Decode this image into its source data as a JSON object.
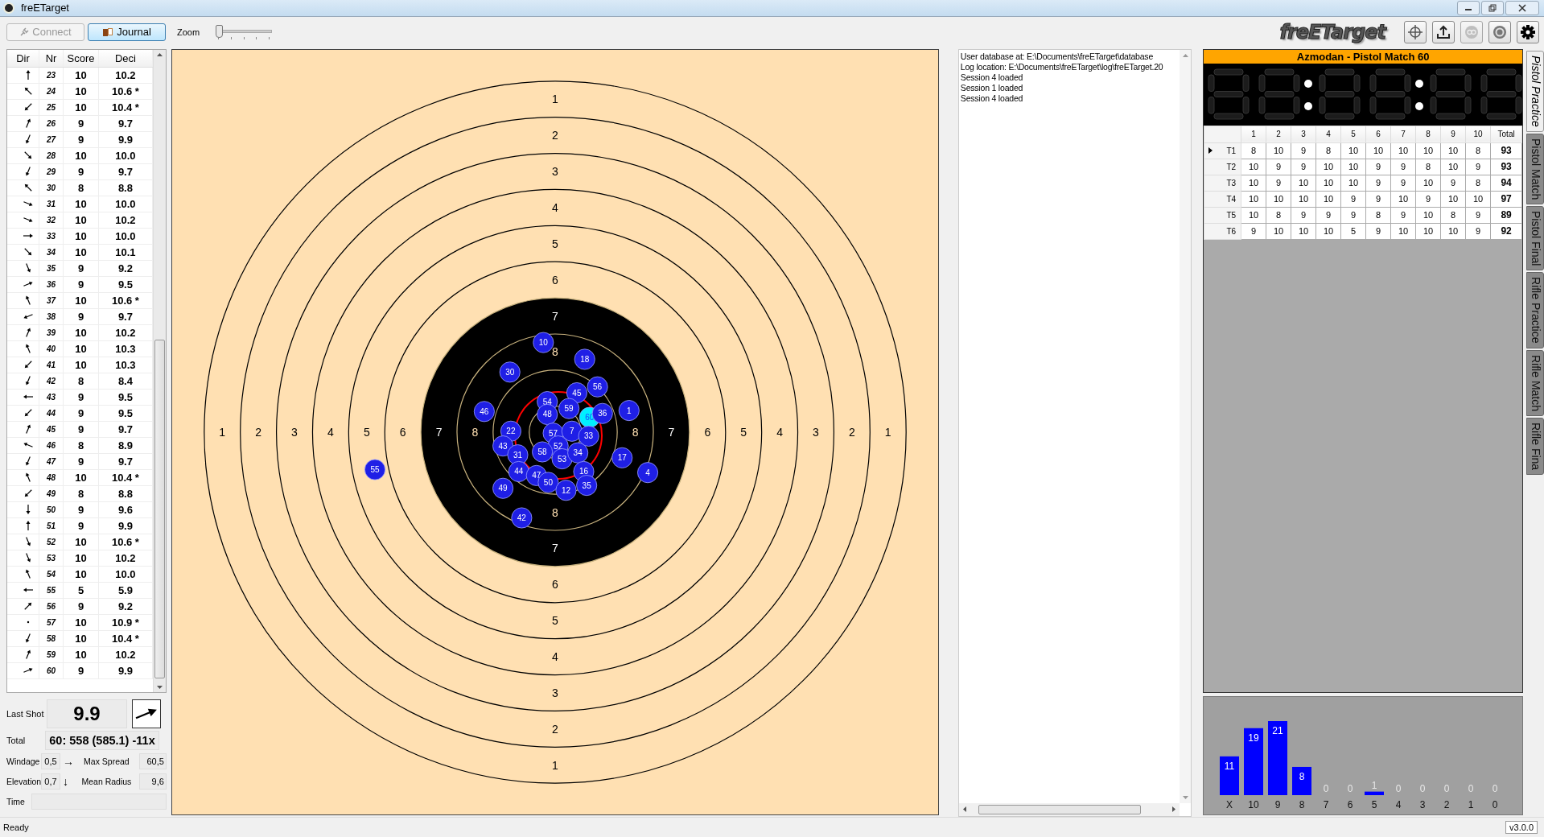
{
  "window": {
    "title": "freETarget"
  },
  "toolbar": {
    "connect": {
      "label": "Connect",
      "disabled": true
    },
    "journal": {
      "label": "Journal",
      "disabled": false
    },
    "zoom": {
      "label": "Zoom",
      "level": 0
    },
    "logo": "freETarget",
    "tool_buttons": [
      {
        "kind": "crosshair",
        "disabled": false
      },
      {
        "kind": "upload",
        "disabled": false
      },
      {
        "kind": "link",
        "disabled": true
      },
      {
        "kind": "target",
        "disabled": false
      },
      {
        "kind": "settings",
        "disabled": false
      }
    ]
  },
  "shot_table": {
    "columns": [
      "Dir",
      "Nr",
      "Score",
      "Deci"
    ],
    "rows": [
      {
        "kind": "N",
        "nr": "23",
        "score": "10",
        "deci": "10.2"
      },
      {
        "kind": "NW",
        "nr": "24",
        "score": "10",
        "deci": "10.6 *"
      },
      {
        "kind": "SW",
        "nr": "25",
        "score": "10",
        "deci": "10.4 *"
      },
      {
        "kind": "NNE",
        "nr": "26",
        "score": "9",
        "deci": "9.7"
      },
      {
        "kind": "SSW",
        "nr": "27",
        "score": "9",
        "deci": "9.9"
      },
      {
        "kind": "SE",
        "nr": "28",
        "score": "10",
        "deci": "10.0"
      },
      {
        "kind": "SSW",
        "nr": "29",
        "score": "9",
        "deci": "9.7"
      },
      {
        "kind": "NW",
        "nr": "30",
        "score": "8",
        "deci": "8.8"
      },
      {
        "kind": "ESE",
        "nr": "31",
        "score": "10",
        "deci": "10.0"
      },
      {
        "kind": "ESE",
        "nr": "32",
        "score": "10",
        "deci": "10.2"
      },
      {
        "kind": "E",
        "nr": "33",
        "score": "10",
        "deci": "10.0"
      },
      {
        "kind": "SE",
        "nr": "34",
        "score": "10",
        "deci": "10.1"
      },
      {
        "kind": "SSE",
        "nr": "35",
        "score": "9",
        "deci": "9.2"
      },
      {
        "kind": "ENE",
        "nr": "36",
        "score": "9",
        "deci": "9.5"
      },
      {
        "kind": "NNW",
        "nr": "37",
        "score": "10",
        "deci": "10.6 *"
      },
      {
        "kind": "WSW",
        "nr": "38",
        "score": "9",
        "deci": "9.7"
      },
      {
        "kind": "NNE",
        "nr": "39",
        "score": "10",
        "deci": "10.2"
      },
      {
        "kind": "NNW",
        "nr": "40",
        "score": "10",
        "deci": "10.3"
      },
      {
        "kind": "SW",
        "nr": "41",
        "score": "10",
        "deci": "10.3"
      },
      {
        "kind": "SSW",
        "nr": "42",
        "score": "8",
        "deci": "8.4"
      },
      {
        "kind": "W",
        "nr": "43",
        "score": "9",
        "deci": "9.5"
      },
      {
        "kind": "SW",
        "nr": "44",
        "score": "9",
        "deci": "9.5"
      },
      {
        "kind": "NNE",
        "nr": "45",
        "score": "9",
        "deci": "9.7"
      },
      {
        "kind": "WNW",
        "nr": "46",
        "score": "8",
        "deci": "8.9"
      },
      {
        "kind": "SSW",
        "nr": "47",
        "score": "9",
        "deci": "9.7"
      },
      {
        "kind": "NNW",
        "nr": "48",
        "score": "10",
        "deci": "10.4 *"
      },
      {
        "kind": "SW",
        "nr": "49",
        "score": "8",
        "deci": "8.8"
      },
      {
        "kind": "S",
        "nr": "50",
        "score": "9",
        "deci": "9.6"
      },
      {
        "kind": "N",
        "nr": "51",
        "score": "9",
        "deci": "9.9"
      },
      {
        "kind": "SSE",
        "nr": "52",
        "score": "10",
        "deci": "10.6 *"
      },
      {
        "kind": "SSE",
        "nr": "53",
        "score": "10",
        "deci": "10.2"
      },
      {
        "kind": "NNW",
        "nr": "54",
        "score": "10",
        "deci": "10.0"
      },
      {
        "kind": "W",
        "nr": "55",
        "score": "5",
        "deci": "5.9"
      },
      {
        "kind": "NE",
        "nr": "56",
        "score": "9",
        "deci": "9.2"
      },
      {
        "kind": "center",
        "nr": "57",
        "score": "10",
        "deci": "10.9 *"
      },
      {
        "kind": "SSW",
        "nr": "58",
        "score": "10",
        "deci": "10.4 *"
      },
      {
        "kind": "NNE",
        "nr": "59",
        "score": "10",
        "deci": "10.2"
      },
      {
        "kind": "ENE",
        "nr": "60",
        "score": "9",
        "deci": "9.9"
      }
    ]
  },
  "stats": {
    "last_shot_label": "Last Shot",
    "last_shot": "9.9",
    "last_arrow": {
      "kind": "ENE"
    },
    "total_label": "Total",
    "total": "60: 558 (585.1) -11x",
    "windage_label": "Windage",
    "windage": "0,5",
    "windage_arrow": "→",
    "max_spread_label": "Max Spread",
    "max_spread": "60,5",
    "elevation_label": "Elevation",
    "elevation": "0,7",
    "elevation_arrow": "↓",
    "mean_radius_label": "Mean Radius",
    "mean_radius": "9,6",
    "time_label": "Time"
  },
  "target": {
    "rings": [
      {
        "labels": [
          "1",
          "1",
          "1",
          "1"
        ]
      },
      {
        "labels": [
          "2",
          "2",
          "2",
          "2"
        ]
      },
      {
        "labels": [
          "3",
          "3",
          "3",
          "3"
        ]
      },
      {
        "labels": [
          "4",
          "4",
          "4",
          "4"
        ]
      },
      {
        "labels": [
          "5",
          "5",
          "5",
          "5"
        ]
      },
      {
        "labels": [
          "6",
          "6",
          "6",
          "6"
        ]
      },
      {
        "labels": [
          "7",
          "7",
          "7",
          "7"
        ]
      },
      {
        "labels": [
          "8",
          "8",
          "8",
          "8"
        ]
      }
    ],
    "shots": [
      {
        "label": "10",
        "latest": false
      },
      {
        "label": "18",
        "latest": false
      },
      {
        "label": "30",
        "latest": false
      },
      {
        "label": "56",
        "latest": false
      },
      {
        "label": "45",
        "latest": false
      },
      {
        "label": "54",
        "latest": false
      },
      {
        "label": "46",
        "latest": false
      },
      {
        "label": "48",
        "latest": false
      },
      {
        "label": "59",
        "latest": false
      },
      {
        "label": "60",
        "latest": true
      },
      {
        "label": "36",
        "latest": false
      },
      {
        "label": "1",
        "latest": false
      },
      {
        "label": "22",
        "latest": false
      },
      {
        "label": "57",
        "latest": false
      },
      {
        "label": "7",
        "latest": false
      },
      {
        "label": "33",
        "latest": false
      },
      {
        "label": "43",
        "latest": false
      },
      {
        "label": "52",
        "latest": false
      },
      {
        "label": "31",
        "latest": false
      },
      {
        "label": "58",
        "latest": false
      },
      {
        "label": "53",
        "latest": false
      },
      {
        "label": "34",
        "latest": false
      },
      {
        "label": "17",
        "latest": false
      },
      {
        "label": "55",
        "latest": false
      },
      {
        "label": "44",
        "latest": false
      },
      {
        "label": "47",
        "latest": false
      },
      {
        "label": "16",
        "latest": false
      },
      {
        "label": "4",
        "latest": false
      },
      {
        "label": "49",
        "latest": false
      },
      {
        "label": "50",
        "latest": false
      },
      {
        "label": "12",
        "latest": false
      },
      {
        "label": "35",
        "latest": false
      },
      {
        "label": "42",
        "latest": false
      }
    ]
  },
  "log": {
    "lines": [
      "User database at: E:\\Documents\\freETarget\\database",
      "Log location: E:\\Documents\\freETarget\\log\\freETarget.20",
      "Session 4 loaded",
      "Session 1 loaded",
      "Session 4 loaded"
    ]
  },
  "match": {
    "title": "Azmodan - Pistol Match 60",
    "columns": [
      "1",
      "2",
      "3",
      "4",
      "5",
      "6",
      "7",
      "8",
      "9",
      "10",
      "Total"
    ],
    "rows": [
      {
        "name": "T1",
        "selected": true,
        "scores": [
          "8",
          "10",
          "9",
          "8",
          "10",
          "10",
          "10",
          "10",
          "10",
          "8"
        ],
        "total": "93"
      },
      {
        "name": "T2",
        "selected": false,
        "scores": [
          "10",
          "9",
          "9",
          "10",
          "10",
          "9",
          "9",
          "8",
          "10",
          "9"
        ],
        "total": "93"
      },
      {
        "name": "T3",
        "selected": false,
        "scores": [
          "10",
          "9",
          "10",
          "10",
          "10",
          "9",
          "9",
          "10",
          "9",
          "8"
        ],
        "total": "94"
      },
      {
        "name": "T4",
        "selected": false,
        "scores": [
          "10",
          "10",
          "10",
          "10",
          "9",
          "9",
          "10",
          "9",
          "10",
          "10"
        ],
        "total": "97"
      },
      {
        "name": "T5",
        "selected": false,
        "scores": [
          "10",
          "8",
          "9",
          "9",
          "9",
          "8",
          "9",
          "10",
          "8",
          "9"
        ],
        "total": "89"
      },
      {
        "name": "T6",
        "selected": false,
        "scores": [
          "9",
          "10",
          "10",
          "10",
          "5",
          "9",
          "10",
          "10",
          "10",
          "9"
        ],
        "total": "92"
      }
    ]
  },
  "histogram": {
    "chart_data": {
      "type": "bar",
      "categories": [
        "X",
        "10",
        "9",
        "8",
        "7",
        "6",
        "5",
        "4",
        "3",
        "2",
        "1",
        "0"
      ],
      "values": [
        11,
        19,
        21,
        8,
        0,
        0,
        1,
        0,
        0,
        0,
        0,
        0
      ],
      "data_labels": true
    }
  },
  "side_tabs": [
    {
      "label": "Pistol Practice",
      "selected": true
    },
    {
      "label": "Pistol Match",
      "selected": false
    },
    {
      "label": "Pistol Final",
      "selected": false
    },
    {
      "label": "Rifle Practice",
      "selected": false
    },
    {
      "label": "Rifle Match",
      "selected": false
    },
    {
      "label": "Rifle Fina",
      "selected": false
    }
  ],
  "status_bar": {
    "text": "Ready",
    "version": "v3.0.0"
  }
}
